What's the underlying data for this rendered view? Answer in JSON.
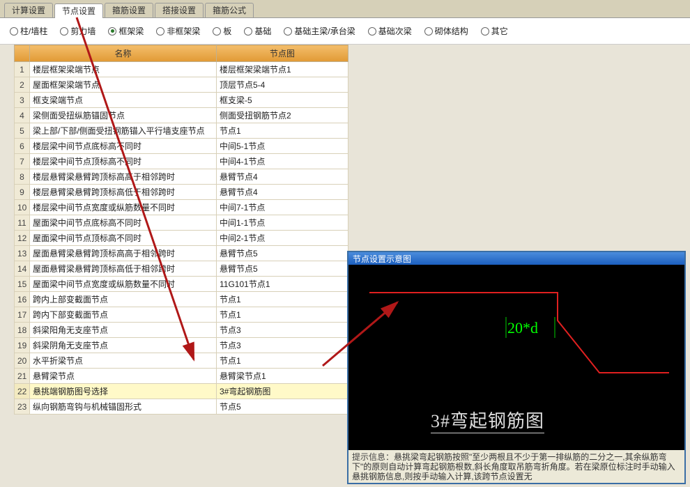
{
  "tabs": [
    {
      "label": "计算设置"
    },
    {
      "label": "节点设置"
    },
    {
      "label": "箍筋设置"
    },
    {
      "label": "搭接设置"
    },
    {
      "label": "箍筋公式"
    }
  ],
  "activeTabIndex": 1,
  "radios": [
    {
      "label": "柱/墙柱"
    },
    {
      "label": "剪力墙"
    },
    {
      "label": "框架梁"
    },
    {
      "label": "非框架梁"
    },
    {
      "label": "板"
    },
    {
      "label": "基础"
    },
    {
      "label": "基础主梁/承台梁"
    },
    {
      "label": "基础次梁"
    },
    {
      "label": "砌体结构"
    },
    {
      "label": "其它"
    }
  ],
  "radioSelectedIndex": 2,
  "table": {
    "headers": {
      "name": "名称",
      "diagram": "节点图"
    },
    "rows": [
      {
        "n": "1",
        "name": "楼层框架梁端节点",
        "d": "楼层框架梁端节点1"
      },
      {
        "n": "2",
        "name": "屋面框架梁端节点",
        "d": "顶层节点5-4"
      },
      {
        "n": "3",
        "name": "框支梁端节点",
        "d": "框支梁-5"
      },
      {
        "n": "4",
        "name": "梁侧面受扭纵筋锚固节点",
        "d": "侧面受扭钢筋节点2"
      },
      {
        "n": "5",
        "name": "梁上部/下部/侧面受扭钢筋锚入平行墙支座节点",
        "d": "节点1"
      },
      {
        "n": "6",
        "name": "楼层梁中间节点底标高不同时",
        "d": "中间5-1节点"
      },
      {
        "n": "7",
        "name": "楼层梁中间节点顶标高不同时",
        "d": "中间4-1节点"
      },
      {
        "n": "8",
        "name": "楼层悬臂梁悬臂跨顶标高高于相邻跨时",
        "d": "悬臂节点4"
      },
      {
        "n": "9",
        "name": "楼层悬臂梁悬臂跨顶标高低于相邻跨时",
        "d": "悬臂节点4"
      },
      {
        "n": "10",
        "name": "楼层梁中间节点宽度或纵筋数量不同时",
        "d": "中间7-1节点"
      },
      {
        "n": "11",
        "name": "屋面梁中间节点底标高不同时",
        "d": "中间1-1节点"
      },
      {
        "n": "12",
        "name": "屋面梁中间节点顶标高不同时",
        "d": "中间2-1节点"
      },
      {
        "n": "13",
        "name": "屋面悬臂梁悬臂跨顶标高高于相邻跨时",
        "d": "悬臂节点5"
      },
      {
        "n": "14",
        "name": "屋面悬臂梁悬臂跨顶标高低于相邻跨时",
        "d": "悬臂节点5"
      },
      {
        "n": "15",
        "name": "屋面梁中间节点宽度或纵筋数量不同时",
        "d": "11G101节点1"
      },
      {
        "n": "16",
        "name": "跨内上部变截面节点",
        "d": "节点1"
      },
      {
        "n": "17",
        "name": "跨内下部变截面节点",
        "d": "节点1"
      },
      {
        "n": "18",
        "name": "斜梁阳角无支座节点",
        "d": "节点3"
      },
      {
        "n": "19",
        "name": "斜梁阴角无支座节点",
        "d": "节点3"
      },
      {
        "n": "20",
        "name": "水平折梁节点",
        "d": "节点1"
      },
      {
        "n": "21",
        "name": "悬臂梁节点",
        "d": "悬臂梁节点1"
      },
      {
        "n": "22",
        "name": "悬挑端钢筋图号选择",
        "d": "3#弯起钢筋图"
      },
      {
        "n": "23",
        "name": "纵向钢筋弯钩与机械锚固形式",
        "d": "节点5"
      }
    ],
    "selectedIndex": 21
  },
  "preview": {
    "title": "节点设置示意图",
    "measureLabel": "20*d",
    "caption": "3#弯起钢筋图",
    "infoLabel": "提示信息：",
    "infoText": "悬挑梁弯起钢筋按照\"至少两根且不少于第一排纵筋的二分之一,其余纵筋弯下\"的原则自动计算弯起钢筋根数,斜长角度取吊筋弯折角度。若在梁原位标注时手动输入悬挑钢筋信息,则按手动输入计算,该跨节点设置无"
  }
}
